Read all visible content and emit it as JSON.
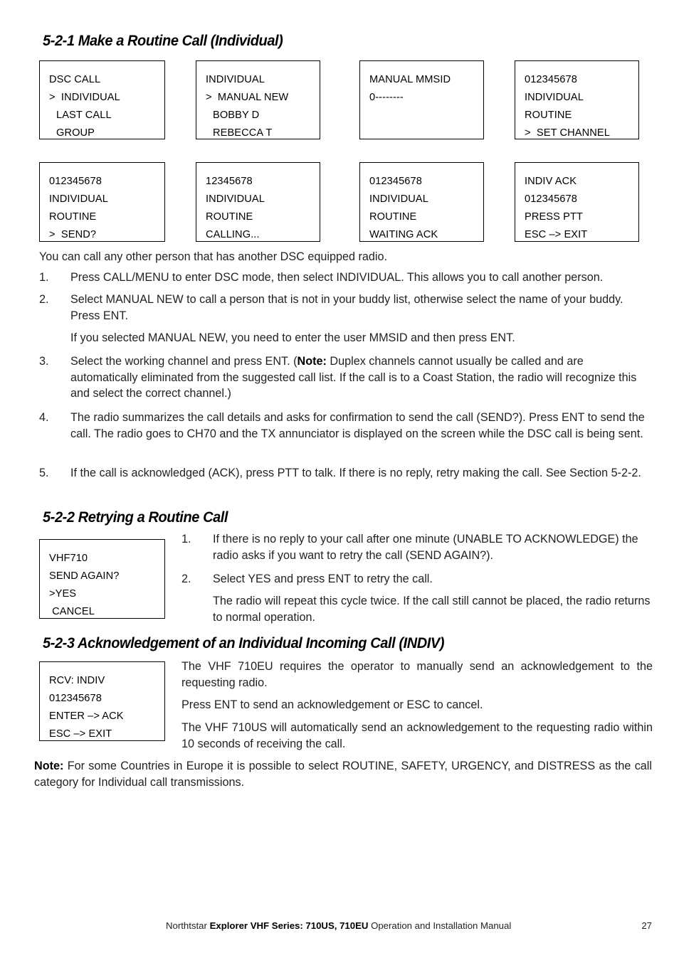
{
  "sections": {
    "s521": {
      "heading": "5-2-1 Make a Routine Call (Individual)",
      "intro": "You can call any other person that has another DSC equipped radio.",
      "steps": [
        {
          "num": "1.",
          "text": "Press CALL/MENU to enter DSC mode, then select INDIVIDUAL. This allows you to call another person."
        },
        {
          "num": "2.",
          "text": "Select MANUAL NEW to call a person that is not in your buddy list, otherwise select the name of your buddy. Press ENT."
        },
        {
          "num": "3.",
          "text_before_note": "Select the working channel and press ENT. (",
          "note_label": "Note:",
          "text_after_note": " Duplex channels cannot usually be called and are automatically eliminated from the suggested call list. If the call is to a Coast Station, the radio will recognize this and select the correct channel.)"
        },
        {
          "num": "4.",
          "text": "The radio summarizes the call details and asks for confirmation to send the call (SEND?). Press ENT to send the call. The radio goes to CH70 and the TX annunciator is displayed on the screen while the DSC call is being sent."
        },
        {
          "num": "5.",
          "text": "If the call is acknowledged (ACK), press PTT to talk. If there is no reply, retry making the call. See Section 5-2-2."
        }
      ],
      "step2_subnote": "If you selected MANUAL NEW, you need to enter the user MMSID and then press ENT."
    },
    "s522": {
      "heading": "5-2-2 Retrying a Routine Call",
      "steps": [
        {
          "num": "1.",
          "text": "If there is no reply to your call after one minute (UNABLE TO ACKNOWLEDGE) the radio asks if you want to retry the call (SEND AGAIN?)."
        },
        {
          "num": "2.",
          "text": "Select YES and press ENT to retry the call."
        }
      ],
      "step2_subnote": "The radio will repeat this cycle twice. If the call still cannot be placed, the radio returns to normal operation."
    },
    "s523": {
      "heading": "5-2-3 Acknowledgement of an Individual Incoming Call (INDIV)",
      "paragraphs": [
        "The VHF 710EU requires the operator to manually send an acknowledgement to the requesting radio.",
        "Press ENT to send an acknowledgement or ESC to cancel.",
        "The VHF 710US will automatically send an acknowledgement to the requesting radio within 10 seconds of receiving the call."
      ]
    }
  },
  "bottom_note": {
    "label": "Note:",
    "text": " For some Countries in Europe it is possible to select ROUTINE, SAFETY, URGENCY, and DISTRESS as the call category for Individual call transmissions."
  },
  "lcd_screens": {
    "dsc_call": {
      "l1": "DSC CALL",
      "l2": ">  INDIVIDUAL",
      "l3": "LAST CALL",
      "l4": "GROUP"
    },
    "individual": {
      "l1": "INDIVIDUAL",
      "l2": ">  MANUAL NEW",
      "l3": "BOBBY D",
      "l4": "REBECCA T"
    },
    "manual_mmsid": {
      "l1": "MANUAL MMSID",
      "l2": "0--------",
      "l3": "",
      "l4": ""
    },
    "set_channel": {
      "l1": "012345678",
      "l2": "INDIVIDUAL",
      "l3": "ROUTINE",
      "l4": ">  SET CHANNEL"
    },
    "send": {
      "l1": "012345678",
      "l2": "INDIVIDUAL",
      "l3": "ROUTINE",
      "l4": ">  SEND?"
    },
    "calling": {
      "l1": "12345678",
      "l2": "INDIVIDUAL",
      "l3": "ROUTINE",
      "l4": "CALLING..."
    },
    "waiting_ack": {
      "l1": "012345678",
      "l2": "INDIVIDUAL",
      "l3": "ROUTINE",
      "l4": "WAITING ACK"
    },
    "indiv_ack": {
      "l1": "INDIV ACK",
      "l2": "012345678",
      "l3": "PRESS PTT",
      "l4": "ESC –> EXIT"
    },
    "send_again": {
      "l1": "VHF710",
      "l2": "SEND AGAIN?",
      "l3": ">YES",
      "l4": " CANCEL"
    },
    "rcv_indiv": {
      "l1": "RCV: INDIV",
      "l2": "012345678",
      "l3": "ENTER –> ACK",
      "l4": "ESC –> EXIT"
    }
  },
  "footer": {
    "brand": "Northtstar ",
    "product": "Explorer VHF Series: 710US, 710EU",
    "tail": " Operation and Installation Manual",
    "page": "27"
  }
}
